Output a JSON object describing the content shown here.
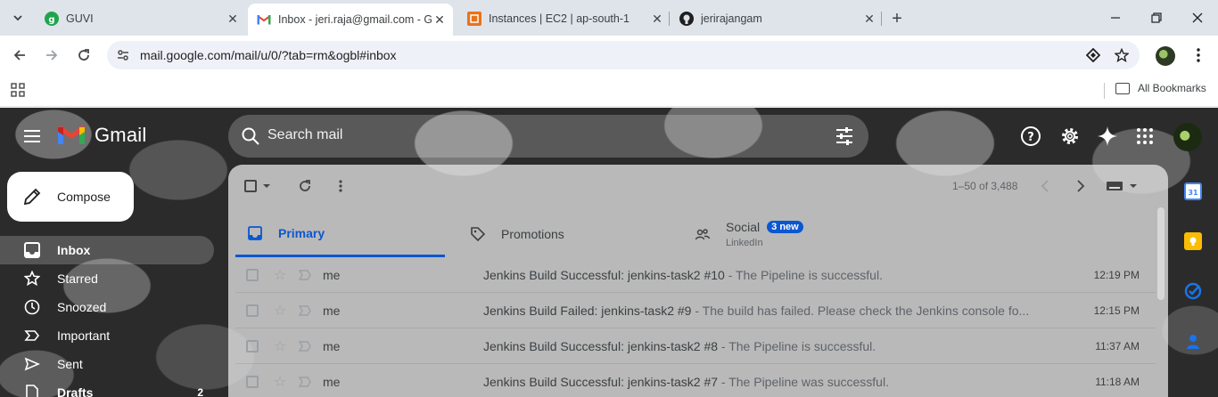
{
  "browser": {
    "tabs": [
      {
        "title": "GUVI",
        "favicon": "guvi-logo"
      },
      {
        "title": "Inbox - jeri.raja@gmail.com - G",
        "favicon": "gmail-logo",
        "active": true
      },
      {
        "title": "Instances | EC2 | ap-south-1",
        "favicon": "aws-logo"
      },
      {
        "title": "jerirajangam",
        "favicon": "github-logo"
      }
    ],
    "url": "mail.google.com/mail/u/0/?tab=rm&ogbl#inbox",
    "bookmarks_label": "All Bookmarks"
  },
  "gmail": {
    "logo_text": "Gmail",
    "search_placeholder": "Search mail",
    "compose_label": "Compose",
    "nav": [
      {
        "label": "Inbox",
        "icon": "inbox-icon",
        "active": true
      },
      {
        "label": "Starred",
        "icon": "star-icon"
      },
      {
        "label": "Snoozed",
        "icon": "clock-icon"
      },
      {
        "label": "Important",
        "icon": "important-icon"
      },
      {
        "label": "Sent",
        "icon": "send-icon"
      },
      {
        "label": "Drafts",
        "icon": "draft-icon",
        "count": "2"
      }
    ],
    "page_info": "1–50 of 3,488",
    "tabs": {
      "primary": "Primary",
      "promotions": "Promotions",
      "social": "Social",
      "social_badge": "3 new",
      "social_sub": "LinkedIn"
    },
    "emails": [
      {
        "sender": "me",
        "subject": "Jenkins Build Successful: jenkins-task2 #10",
        "snippet": " - The Pipeline is successful.",
        "time": "12:19 PM"
      },
      {
        "sender": "me",
        "subject": "Jenkins Build Failed: jenkins-task2 #9",
        "snippet": " - The build has failed. Please check the Jenkins console fo...",
        "time": "12:15 PM"
      },
      {
        "sender": "me",
        "subject": "Jenkins Build Successful: jenkins-task2 #8",
        "snippet": " - The Pipeline is successful.",
        "time": "11:37 AM"
      },
      {
        "sender": "me",
        "subject": "Jenkins Build Successful: jenkins-task2 #7",
        "snippet": " - The Pipeline was successful.",
        "time": "11:18 AM"
      }
    ]
  },
  "colors": {
    "accent": "#0b57d0",
    "tabstrip": "#dfe3ea",
    "omnibox": "#eef1f8"
  }
}
